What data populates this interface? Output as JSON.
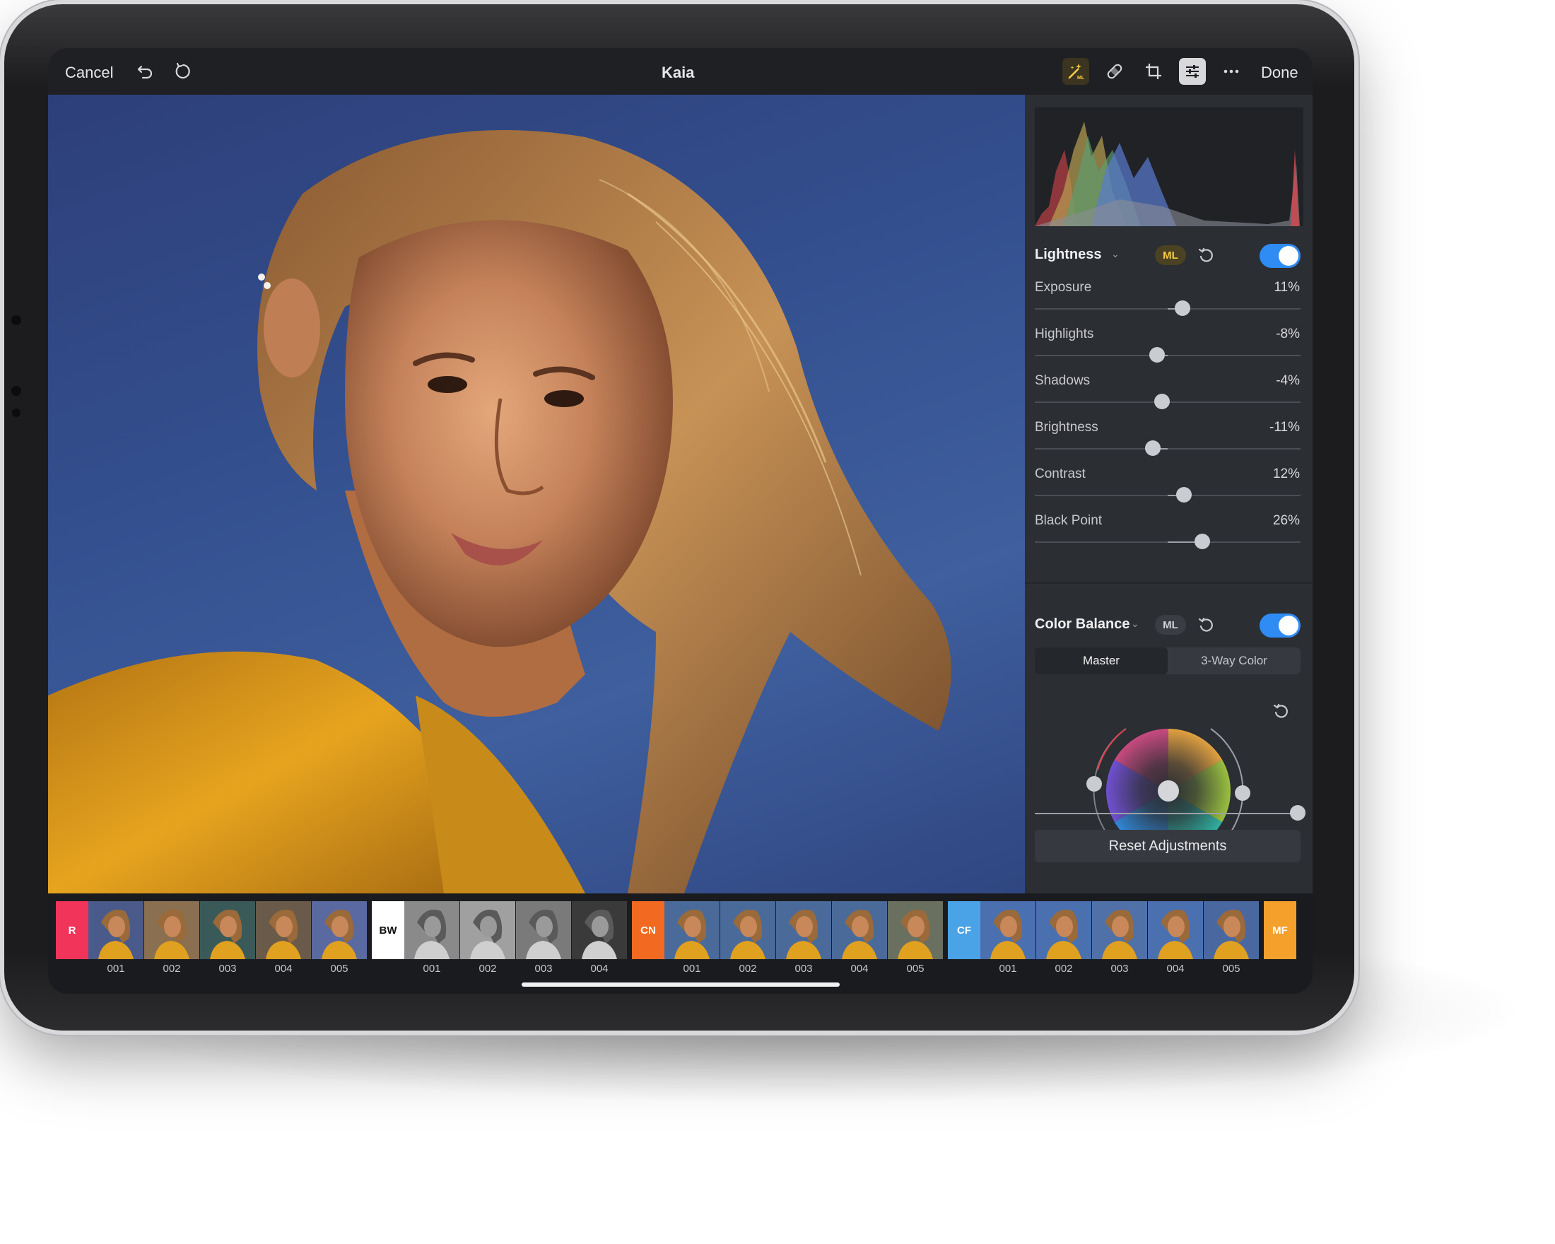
{
  "topbar": {
    "cancel": "Cancel",
    "title": "Kaia",
    "done": "Done",
    "icons": [
      "undo-icon",
      "redo-icon",
      "ml-magic-wand-icon",
      "bandage-repair-icon",
      "crop-icon",
      "adjust-sliders-icon",
      "more-icon"
    ]
  },
  "lightness": {
    "title": "Lightness",
    "ml": "ML",
    "sliders": [
      {
        "label": "Exposure",
        "value": "11%",
        "level": 0.11
      },
      {
        "label": "Highlights",
        "value": "-8%",
        "level": -0.08
      },
      {
        "label": "Shadows",
        "value": "-4%",
        "level": -0.04
      },
      {
        "label": "Brightness",
        "value": "-11%",
        "level": -0.11
      },
      {
        "label": "Contrast",
        "value": "12%",
        "level": 0.12
      },
      {
        "label": "Black Point",
        "value": "26%",
        "level": 0.26
      }
    ]
  },
  "color_balance": {
    "title": "Color Balance",
    "ml": "ML",
    "tabs": [
      "Master",
      "3-Way Color"
    ],
    "active_tab": "Master",
    "intensity_level": 1.0
  },
  "reset_label": "Reset Adjustments",
  "filmstrip": {
    "groups": [
      {
        "tag": "R",
        "color": "#f0345a",
        "text_color": "#ffffff",
        "items": [
          "001",
          "002",
          "003",
          "004",
          "005"
        ]
      },
      {
        "tag": "BW",
        "color": "#ffffff",
        "text_color": "#111111",
        "items": [
          "001",
          "002",
          "003",
          "004"
        ]
      },
      {
        "tag": "CN",
        "color": "#f26a22",
        "text_color": "#ffffff",
        "items": [
          "001",
          "002",
          "003",
          "004",
          "005"
        ]
      },
      {
        "tag": "CF",
        "color": "#4aa3e6",
        "text_color": "#ffffff",
        "items": [
          "001",
          "002",
          "003",
          "004",
          "005"
        ]
      },
      {
        "tag": "MF",
        "color": "#f4a02d",
        "text_color": "#ffffff",
        "items": []
      }
    ]
  },
  "colors": {
    "accent": "#2f8cf5",
    "ml_active": "#f7c948",
    "panel": "#2b2e33"
  }
}
